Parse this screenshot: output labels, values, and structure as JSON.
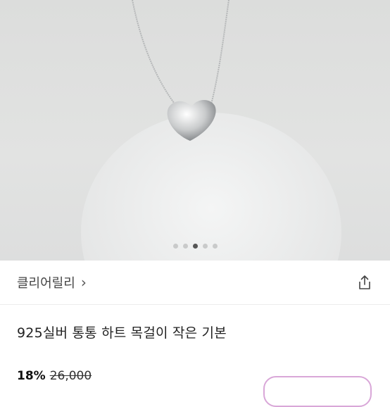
{
  "seller": {
    "name": "클리어릴리"
  },
  "product": {
    "title": "925실버 통통 하트 목걸이 작은 기본",
    "discount": "18%",
    "original_price": "26,000"
  },
  "carousel": {
    "total": 5,
    "active_index": 3
  },
  "icons": {
    "share": "share-icon",
    "chevron": "chevron-right-icon"
  },
  "colors": {
    "accent_outline": "#d9a7d8",
    "dot_active": "#555555",
    "dot_inactive": "#c9caca"
  }
}
